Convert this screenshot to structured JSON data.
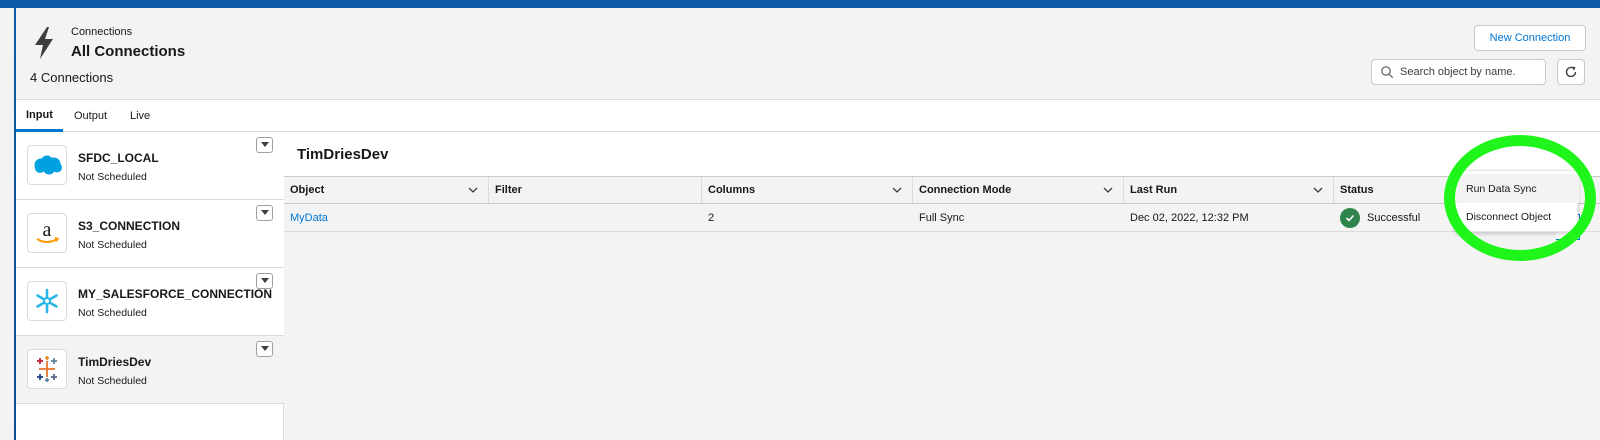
{
  "header": {
    "eyebrow": "Connections",
    "title": "All Connections",
    "count": "4 Connections",
    "new_connection_label": "New Connection",
    "search_placeholder": "Search object by name."
  },
  "tabs": [
    {
      "label": "Input",
      "active": true
    },
    {
      "label": "Output",
      "active": false
    },
    {
      "label": "Live",
      "active": false
    }
  ],
  "connections": [
    {
      "name": "SFDC_LOCAL",
      "schedule": "Not Scheduled",
      "logo": "salesforce-cloud-icon"
    },
    {
      "name": "S3_CONNECTION",
      "schedule": "Not Scheduled",
      "logo": "amazon-icon"
    },
    {
      "name": "MY_SALESFORCE_CONNECTION",
      "schedule": "Not Scheduled",
      "logo": "snowflake-icon"
    },
    {
      "name": "TimDriesDev",
      "schedule": "Not Scheduled",
      "logo": "tableau-icon",
      "selected": true
    }
  ],
  "main": {
    "title": "TimDriesDev",
    "columns": [
      "Object",
      "Filter",
      "Columns",
      "Connection Mode",
      "Last Run",
      "Status"
    ],
    "rows": [
      {
        "object": "MyData",
        "filter": "",
        "columns": "2",
        "connection_mode": "Full Sync",
        "last_run": "Dec 02, 2022, 12:32 PM",
        "status": "Successful"
      }
    ]
  },
  "row_menu": {
    "items": [
      "Run Data Sync",
      "Disconnect Object"
    ]
  },
  "colors": {
    "brand_blue": "#0176d3",
    "success_green": "#2e844a",
    "annotation_green": "#1ff51a"
  }
}
